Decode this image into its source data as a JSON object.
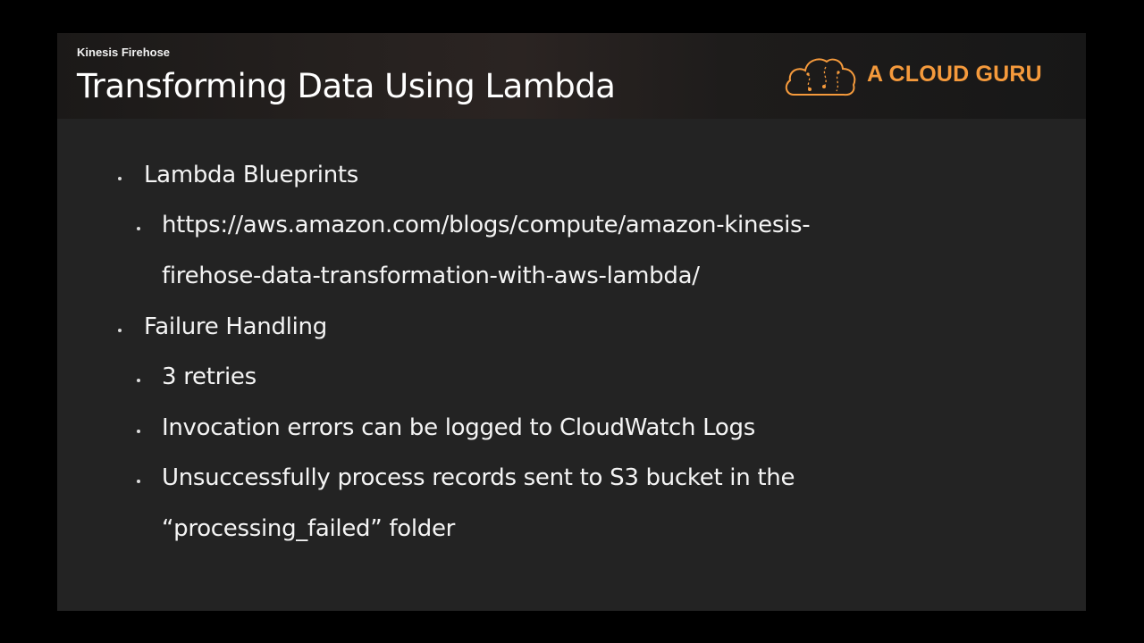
{
  "header": {
    "subtitle": "Kinesis Firehose",
    "title": "Transforming Data Using Lambda",
    "logo_text": "A CLOUD GURU"
  },
  "bullets": [
    {
      "level": 1,
      "text": "Lambda Blueprints"
    },
    {
      "level": 2,
      "lines": [
        "https://aws.amazon.com/blogs/compute/amazon-kinesis-",
        "firehose-data-transformation-with-aws-lambda/"
      ]
    },
    {
      "level": 1,
      "text": "Failure Handling"
    },
    {
      "level": 2,
      "text": "3 retries"
    },
    {
      "level": 2,
      "text": "Invocation errors can be logged to CloudWatch Logs"
    },
    {
      "level": 2,
      "lines": [
        "Unsuccessfully process records sent to S3 bucket in the",
        "“processing_failed” folder"
      ]
    }
  ],
  "colors": {
    "accent": "#f59a3c",
    "slide_background": "#232323",
    "text": "#f4f4f4"
  },
  "icons": {
    "logo": "cloud-icon"
  }
}
